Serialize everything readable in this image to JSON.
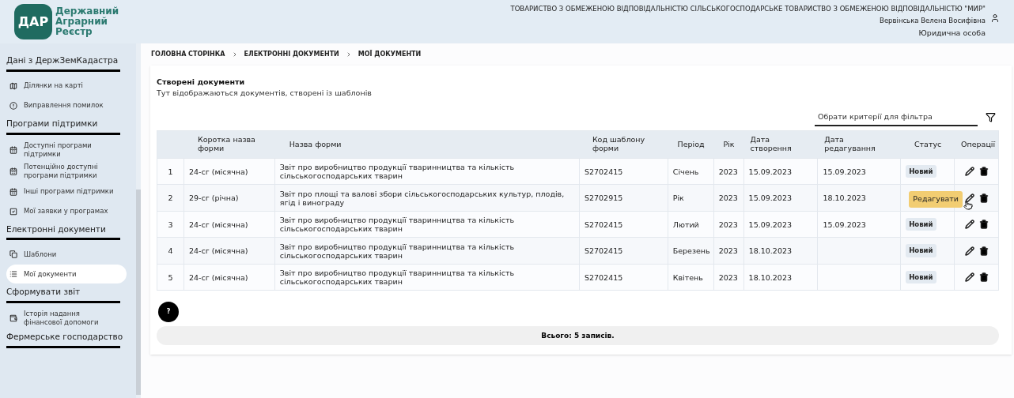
{
  "logo": {
    "mark": "ДАР",
    "name": [
      "Державний",
      "Аграрний",
      "Реєстр"
    ]
  },
  "header": {
    "organization": "ТОВАРИСТВО З ОБМЕЖЕНОЮ ВІДПОВІДАЛЬНІСТЮ СІЛЬСЬКОГОСПОДАРСЬКЕ ТОВАРИСТВО З ОБМЕЖЕНОЮ ВІДПОВІДАЛЬНІСТЮ \"МИР\"",
    "user_name": "Вервінська Велена Восифівна",
    "user_role": "Юридична особа"
  },
  "sidebar": {
    "sections": [
      {
        "title": "Дані з ДержЗемКадастра",
        "items": [
          {
            "label": "Ділянки на карті",
            "selected": false
          },
          {
            "label": "Виправлення помилок",
            "selected": false
          }
        ]
      },
      {
        "title": "Програми підтримки",
        "items": [
          {
            "label": "Доступні програми підтримки",
            "selected": false
          },
          {
            "label": "Потенційно доступні програми підтримки",
            "selected": false
          },
          {
            "label": "Інші програми підтримки",
            "selected": false
          },
          {
            "label": "Мої заявки у програмах",
            "selected": false
          }
        ]
      },
      {
        "title": "Електронні документи",
        "items": [
          {
            "label": "Шаблони",
            "selected": false
          },
          {
            "label": "Мої документи",
            "selected": true
          }
        ]
      },
      {
        "title": "Сформувати звіт",
        "items": [
          {
            "label": "Історія надання фінансової допомоги",
            "selected": false
          }
        ]
      },
      {
        "title": "Фермерське господарство"
      }
    ]
  },
  "breadcrumbs": [
    "ГОЛОВНА СТОРІНКА",
    "ЕЛЕКТРОННІ ДОКУМЕНТИ",
    "МОЇ ДОКУМЕНТИ"
  ],
  "card": {
    "title": "Створені документи",
    "subtitle": "Тут відображаються документів, створені із шаблонів",
    "filter": {
      "placeholder": "Обрати критерії для фільтра"
    }
  },
  "table": {
    "columns": [
      "Коротка назва форми",
      "Назва форми",
      "Код шаблону форми",
      "Період",
      "Рік",
      "Дата створення",
      "Дата редагування",
      "Статус",
      "Операції"
    ],
    "rows": [
      {
        "number": "1",
        "short_name": "24-сг (місячна)",
        "form_name": "Звіт про виробництво продукції тваринництва та кількість сільськогосподарських тварин",
        "code": "S2702415",
        "period": "Січень",
        "year": "2023",
        "created": "15.09.2023",
        "edited": "15.09.2023",
        "status": "Новий"
      },
      {
        "number": "2",
        "short_name": "29-сг (річна)",
        "form_name": "Звіт про площі та валові збори сільськогосподарських культур, плодів, ягід і винограду",
        "code": "S2702915",
        "period": "Рік",
        "year": "2023",
        "created": "15.09.2023",
        "edited": "18.10.2023",
        "tooltip": "Редагувати"
      },
      {
        "number": "3",
        "short_name": "24-сг (місячна)",
        "form_name": "Звіт про виробництво продукції тваринництва та кількість сільськогосподарських тварин",
        "code": "S2702415",
        "period": "Лютий",
        "year": "2023",
        "created": "15.09.2023",
        "edited": "15.09.2023",
        "status": "Новий"
      },
      {
        "number": "4",
        "short_name": "24-сг (місячна)",
        "form_name": "Звіт про виробництво продукції тваринництва та кількість сільськогосподарських тварин",
        "code": "S2702415",
        "period": "Березень",
        "year": "2023",
        "created": "18.10.2023",
        "status": "Новий"
      },
      {
        "number": "5",
        "short_name": "24-сг (місячна)",
        "form_name": "Звіт про виробництво продукції тваринництва та кількість сільськогосподарських тварин",
        "code": "S2702415",
        "period": "Квітень",
        "year": "2023",
        "created": "18.10.2023",
        "status": "Новий"
      }
    ]
  },
  "help_button": "?",
  "total": "Всього: 5 записів."
}
